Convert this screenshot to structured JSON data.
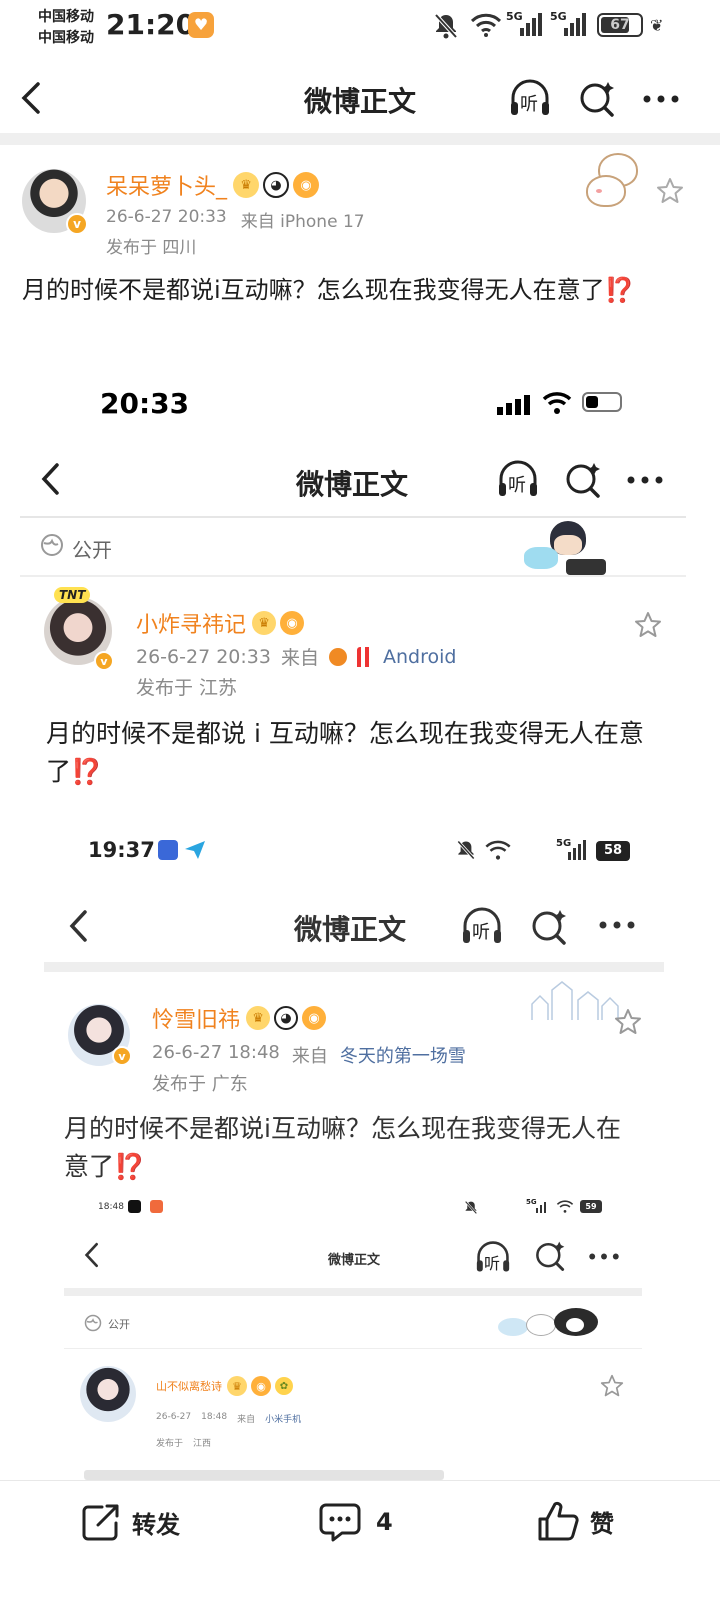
{
  "status_bar": {
    "carrier1": "中国移动",
    "carrier2": "中国移动",
    "time": "21:20",
    "net1": "5G",
    "net2": "5G",
    "battery": "67"
  },
  "header": {
    "title": "微博正文",
    "listen_label": "听"
  },
  "post": {
    "author": "呆呆萝卜头_",
    "timestamp": "26-6-27 20:33",
    "source_prefix": "来自",
    "source": "iPhone 17",
    "location": "发布于 四川",
    "content": "月的时候不是都说i互动嘛？怎么现在我变得无人在意了⁉️"
  },
  "shot1": {
    "time": "20:33",
    "header_title": "微博正文",
    "listen_label": "听",
    "visibility": "公开",
    "author": "小炸寻祎记",
    "timestamp": "26-6-27 20:33",
    "source_prefix": "来自",
    "source": "Android",
    "location": "发布于 江苏",
    "content": "月的时候不是都说 i 互动嘛？怎么现在我变得无人在意了⁉️"
  },
  "shot2": {
    "time": "19:37",
    "net": "5G",
    "battery": "58",
    "header_title": "微博正文",
    "listen_label": "听",
    "author": "怜雪旧祎",
    "timestamp": "26-6-27 18:48",
    "source_prefix": "来自",
    "source": "冬天的第一场雪",
    "location": "发布于 广东",
    "content": "月的时候不是都说i互动嘛？怎么现在我变得无人在意了⁉️"
  },
  "shot3": {
    "time": "18:48",
    "net": "5G",
    "battery": "59",
    "header_title": "微博正文",
    "listen_label": "听",
    "visibility": "公开",
    "author": "山不似离愁诗",
    "date": "26-6-27",
    "time2": "18:48",
    "source_prefix": "来自",
    "source": "小米手机",
    "location": "发布于",
    "location_place": "江西"
  },
  "bottom_bar": {
    "repost": "转发",
    "comment_count": "4",
    "like": "赞"
  },
  "colors": {
    "orange": "#f0821e",
    "link_blue": "#4f6fa0",
    "divider": "#efefef"
  }
}
